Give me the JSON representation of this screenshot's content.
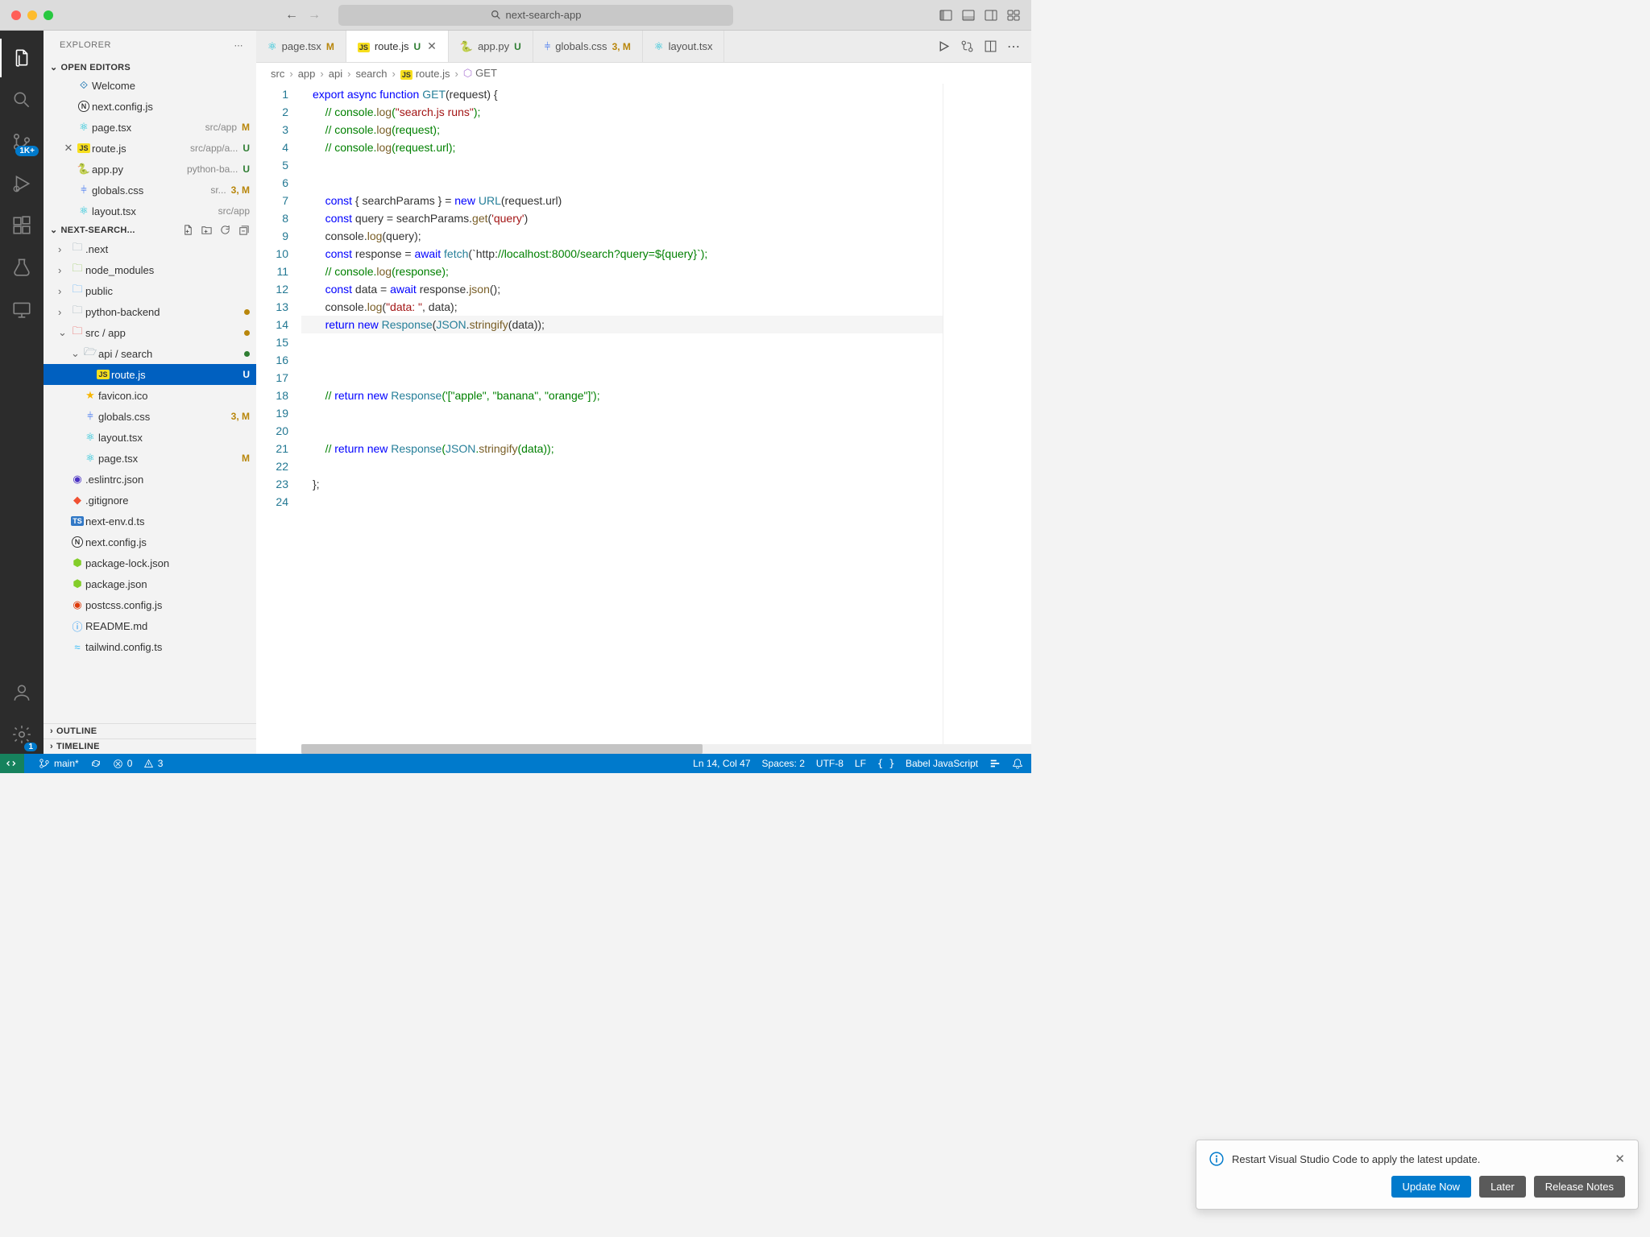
{
  "window": {
    "search": "next-search-app"
  },
  "sidebar": {
    "title": "EXPLORER",
    "openEditors": {
      "title": "OPEN EDITORS",
      "items": [
        {
          "label": "Welcome",
          "meta": ""
        },
        {
          "label": "next.config.js",
          "meta": ""
        },
        {
          "label": "page.tsx",
          "meta": "src/app",
          "tag": "M"
        },
        {
          "label": "route.js",
          "meta": "src/app/a...",
          "tag": "U",
          "active": true
        },
        {
          "label": "app.py",
          "meta": "python-ba...",
          "tag": "U"
        },
        {
          "label": "globals.css",
          "meta": "sr...",
          "tag": "3, M"
        },
        {
          "label": "layout.tsx",
          "meta": "src/app"
        }
      ]
    },
    "project": {
      "title": "NEXT-SEARCH...",
      "tree": [
        {
          "d": 0,
          "t": "folder",
          "label": ".next",
          "icon": "folder-grey",
          "chev": ">"
        },
        {
          "d": 0,
          "t": "folder",
          "label": "node_modules",
          "icon": "folder-green",
          "chev": ">"
        },
        {
          "d": 0,
          "t": "folder",
          "label": "public",
          "icon": "folder-blue",
          "chev": ">"
        },
        {
          "d": 0,
          "t": "folder",
          "label": "python-backend",
          "icon": "folder-grey",
          "chev": ">",
          "dot": "yellow"
        },
        {
          "d": 0,
          "t": "folder",
          "label": "src / app",
          "icon": "folder-src",
          "chev": "v",
          "dot": "yellow"
        },
        {
          "d": 1,
          "t": "folder",
          "label": "api / search",
          "icon": "folder-grey2",
          "chev": "v",
          "dot": "green"
        },
        {
          "d": 2,
          "t": "file",
          "label": "route.js",
          "icon": "js",
          "tag": "U",
          "selected": true
        },
        {
          "d": 1,
          "t": "file",
          "label": "favicon.ico",
          "icon": "star"
        },
        {
          "d": 1,
          "t": "file",
          "label": "globals.css",
          "icon": "css",
          "tag": "3, M"
        },
        {
          "d": 1,
          "t": "file",
          "label": "layout.tsx",
          "icon": "react"
        },
        {
          "d": 1,
          "t": "file",
          "label": "page.tsx",
          "icon": "react",
          "tag": "M"
        },
        {
          "d": 0,
          "t": "file",
          "label": ".eslintrc.json",
          "icon": "eslint"
        },
        {
          "d": 0,
          "t": "file",
          "label": ".gitignore",
          "icon": "git"
        },
        {
          "d": 0,
          "t": "file",
          "label": "next-env.d.ts",
          "icon": "ts"
        },
        {
          "d": 0,
          "t": "file",
          "label": "next.config.js",
          "icon": "next"
        },
        {
          "d": 0,
          "t": "file",
          "label": "package-lock.json",
          "icon": "njs"
        },
        {
          "d": 0,
          "t": "file",
          "label": "package.json",
          "icon": "njs"
        },
        {
          "d": 0,
          "t": "file",
          "label": "postcss.config.js",
          "icon": "postcss"
        },
        {
          "d": 0,
          "t": "file",
          "label": "README.md",
          "icon": "info"
        },
        {
          "d": 0,
          "t": "file",
          "label": "tailwind.config.ts",
          "icon": "tw"
        }
      ]
    },
    "outline": "OUTLINE",
    "timeline": "TIMELINE"
  },
  "tabs": [
    {
      "label": "page.tsx",
      "status": "M",
      "icon": "react"
    },
    {
      "label": "route.js",
      "status": "U",
      "icon": "js",
      "active": true
    },
    {
      "label": "app.py",
      "status": "U",
      "icon": "py"
    },
    {
      "label": "globals.css",
      "status": "3, M",
      "icon": "css"
    },
    {
      "label": "layout.tsx",
      "status": "",
      "icon": "react"
    }
  ],
  "breadcrumb": [
    "src",
    "app",
    "api",
    "search",
    "route.js",
    "GET"
  ],
  "code": {
    "lines": [
      "export async function GET(request) {",
      "    // console.log(\"search.js runs\");",
      "    // console.log(request);",
      "    // console.log(request.url);",
      "",
      "",
      "    const { searchParams } = new URL(request.url)",
      "    const query = searchParams.get('query')",
      "    console.log(query);",
      "    const response = await fetch(`http://localhost:8000/search?query=${query}`);",
      "    // console.log(response);",
      "    const data = await response.json();",
      "    console.log(\"data: \", data);",
      "    return new Response(JSON.stringify(data));",
      "",
      "",
      "",
      "    // return new Response('[\"apple\", \"banana\", \"orange\"]');",
      "",
      "",
      "    // return new Response(JSON.stringify(data));",
      "",
      "};",
      ""
    ]
  },
  "notification": {
    "text": "Restart Visual Studio Code to apply the latest update.",
    "buttons": [
      "Update Now",
      "Later",
      "Release Notes"
    ]
  },
  "status": {
    "branch": "main*",
    "errors": "0",
    "warnings": "3",
    "lncol": "Ln 14, Col 47",
    "spaces": "Spaces: 2",
    "encoding": "UTF-8",
    "eol": "LF",
    "lang": "Babel JavaScript"
  },
  "activityBadge": "1K+",
  "settingsBadge": "1"
}
